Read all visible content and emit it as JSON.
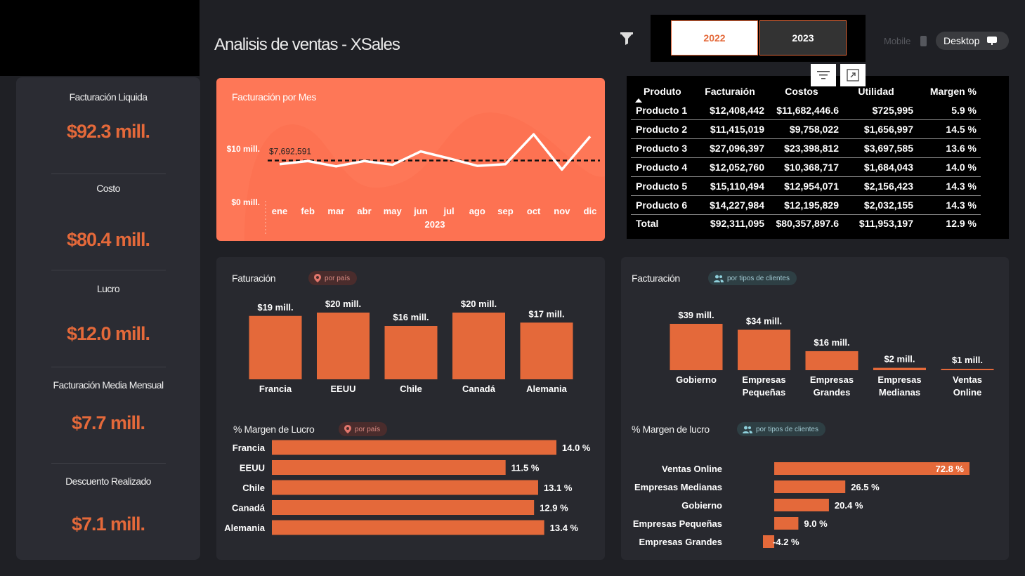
{
  "header": {
    "title": "Analisis de ventas - XSales",
    "year_buttons": [
      "2022",
      "2023"
    ],
    "mobile_label": "Mobile",
    "desktop_label": "Desktop"
  },
  "kpis": [
    {
      "label": "Facturación Liquida",
      "value": "$92.3 mill."
    },
    {
      "label": "Costo",
      "value": "$80.4 mill."
    },
    {
      "label": "Lucro",
      "value": "$12.0 mill."
    },
    {
      "label": "Facturación Media Mensual",
      "value": "$7.7 mill."
    },
    {
      "label": "Descuento Realizado",
      "value": "$7.1 mill."
    }
  ],
  "line_card": {
    "title": "Facturación por Mes"
  },
  "table": {
    "headers": [
      "Produto",
      "Facturaión",
      "Costos",
      "Utilidad",
      "Margen %"
    ],
    "rows": [
      [
        "Producto 1",
        "$12,408,442",
        "$11,682,446.6",
        "$725,995",
        "5.9 %"
      ],
      [
        "Producto 2",
        "$11,415,019",
        "$9,758,022",
        "$1,656,997",
        "14.5 %"
      ],
      [
        "Producto 3",
        "$27,096,397",
        "$23,398,812",
        "$3,697,585",
        "13.6 %"
      ],
      [
        "Producto 4",
        "$12,052,760",
        "$10,368,717",
        "$1,684,043",
        "14.0 %"
      ],
      [
        "Producto 5",
        "$15,110,494",
        "$12,954,071",
        "$2,156,423",
        "14.3 %"
      ],
      [
        "Producto 6",
        "$14,227,984",
        "$12,195,829",
        "$2,032,155",
        "14.3 %"
      ]
    ],
    "total": [
      "Total",
      "$92,311,095",
      "$80,357,897.6",
      "$11,953,197",
      "12.9 %"
    ]
  },
  "cards": {
    "country_rev_title": "Faturación",
    "country_pill": "por país",
    "country_margin_title": "% Margen de Lucro",
    "client_rev_title": "Facturación",
    "client_pill": "por tipos de clientes",
    "client_margin_title": "% Margen de lucro"
  },
  "colors": {
    "accent": "#e4693a",
    "line_bg": "#fe7757",
    "panel": "#2b2c33",
    "background": "#1f2025"
  },
  "chart_data": [
    {
      "type": "line",
      "title": "Facturación por Mes",
      "x": [
        "ene",
        "feb",
        "mar",
        "abr",
        "may",
        "jun",
        "jul",
        "ago",
        "sep",
        "oct",
        "nov",
        "dic"
      ],
      "xlabel": "2023",
      "y_ticks": [
        "$0 mill.",
        "$10 mill."
      ],
      "series": [
        {
          "values": [
            7.0,
            7.6,
            6.6,
            7.6,
            6.9,
            9.4,
            8.1,
            6.7,
            7.0,
            12.6,
            6.0,
            12.2
          ]
        }
      ],
      "average": {
        "value": 7.692591,
        "label": "$7,692,591"
      },
      "ylim": [
        0,
        14.5
      ]
    },
    {
      "type": "bar",
      "categories": [
        "Francia",
        "EEUU",
        "Chile",
        "Canadá",
        "Alemania"
      ],
      "values": [
        19,
        20,
        16,
        20,
        17
      ],
      "labels": [
        "$19 mill.",
        "$20 mill.",
        "$16 mill.",
        "$20 mill.",
        "$17 mill."
      ],
      "ylim": [
        0,
        20
      ]
    },
    {
      "type": "bar",
      "orientation": "horizontal",
      "categories": [
        "Francia",
        "EEUU",
        "Chile",
        "Canadá",
        "Alemania"
      ],
      "values": [
        14.0,
        11.5,
        13.1,
        12.9,
        13.4
      ],
      "labels": [
        "14.0 %",
        "11.5 %",
        "13.1 %",
        "12.9 %",
        "13.4 %"
      ],
      "xlim": [
        0,
        14
      ]
    },
    {
      "type": "bar",
      "categories": [
        "Gobierno",
        "Empresas Pequeñas",
        "Empresas Grandes",
        "Empresas Medianas",
        "Ventas Online"
      ],
      "values": [
        39,
        34,
        16,
        2,
        1
      ],
      "labels": [
        "$39 mill.",
        "$34 mill.",
        "$16 mill.",
        "$2 mill.",
        "$1 mill."
      ],
      "ylim": [
        0,
        39
      ]
    },
    {
      "type": "bar",
      "orientation": "horizontal",
      "categories": [
        "Ventas Online",
        "Empresas Medianas",
        "Gobierno",
        "Empresas Pequeñas",
        "Empresas Grandes"
      ],
      "values": [
        72.8,
        26.5,
        20.4,
        9.0,
        -4.2
      ],
      "labels": [
        "72.8 %",
        "26.5 %",
        "20.4 %",
        "9.0 %",
        "-4.2 %"
      ],
      "xlim": [
        -4.2,
        72.8
      ]
    }
  ]
}
